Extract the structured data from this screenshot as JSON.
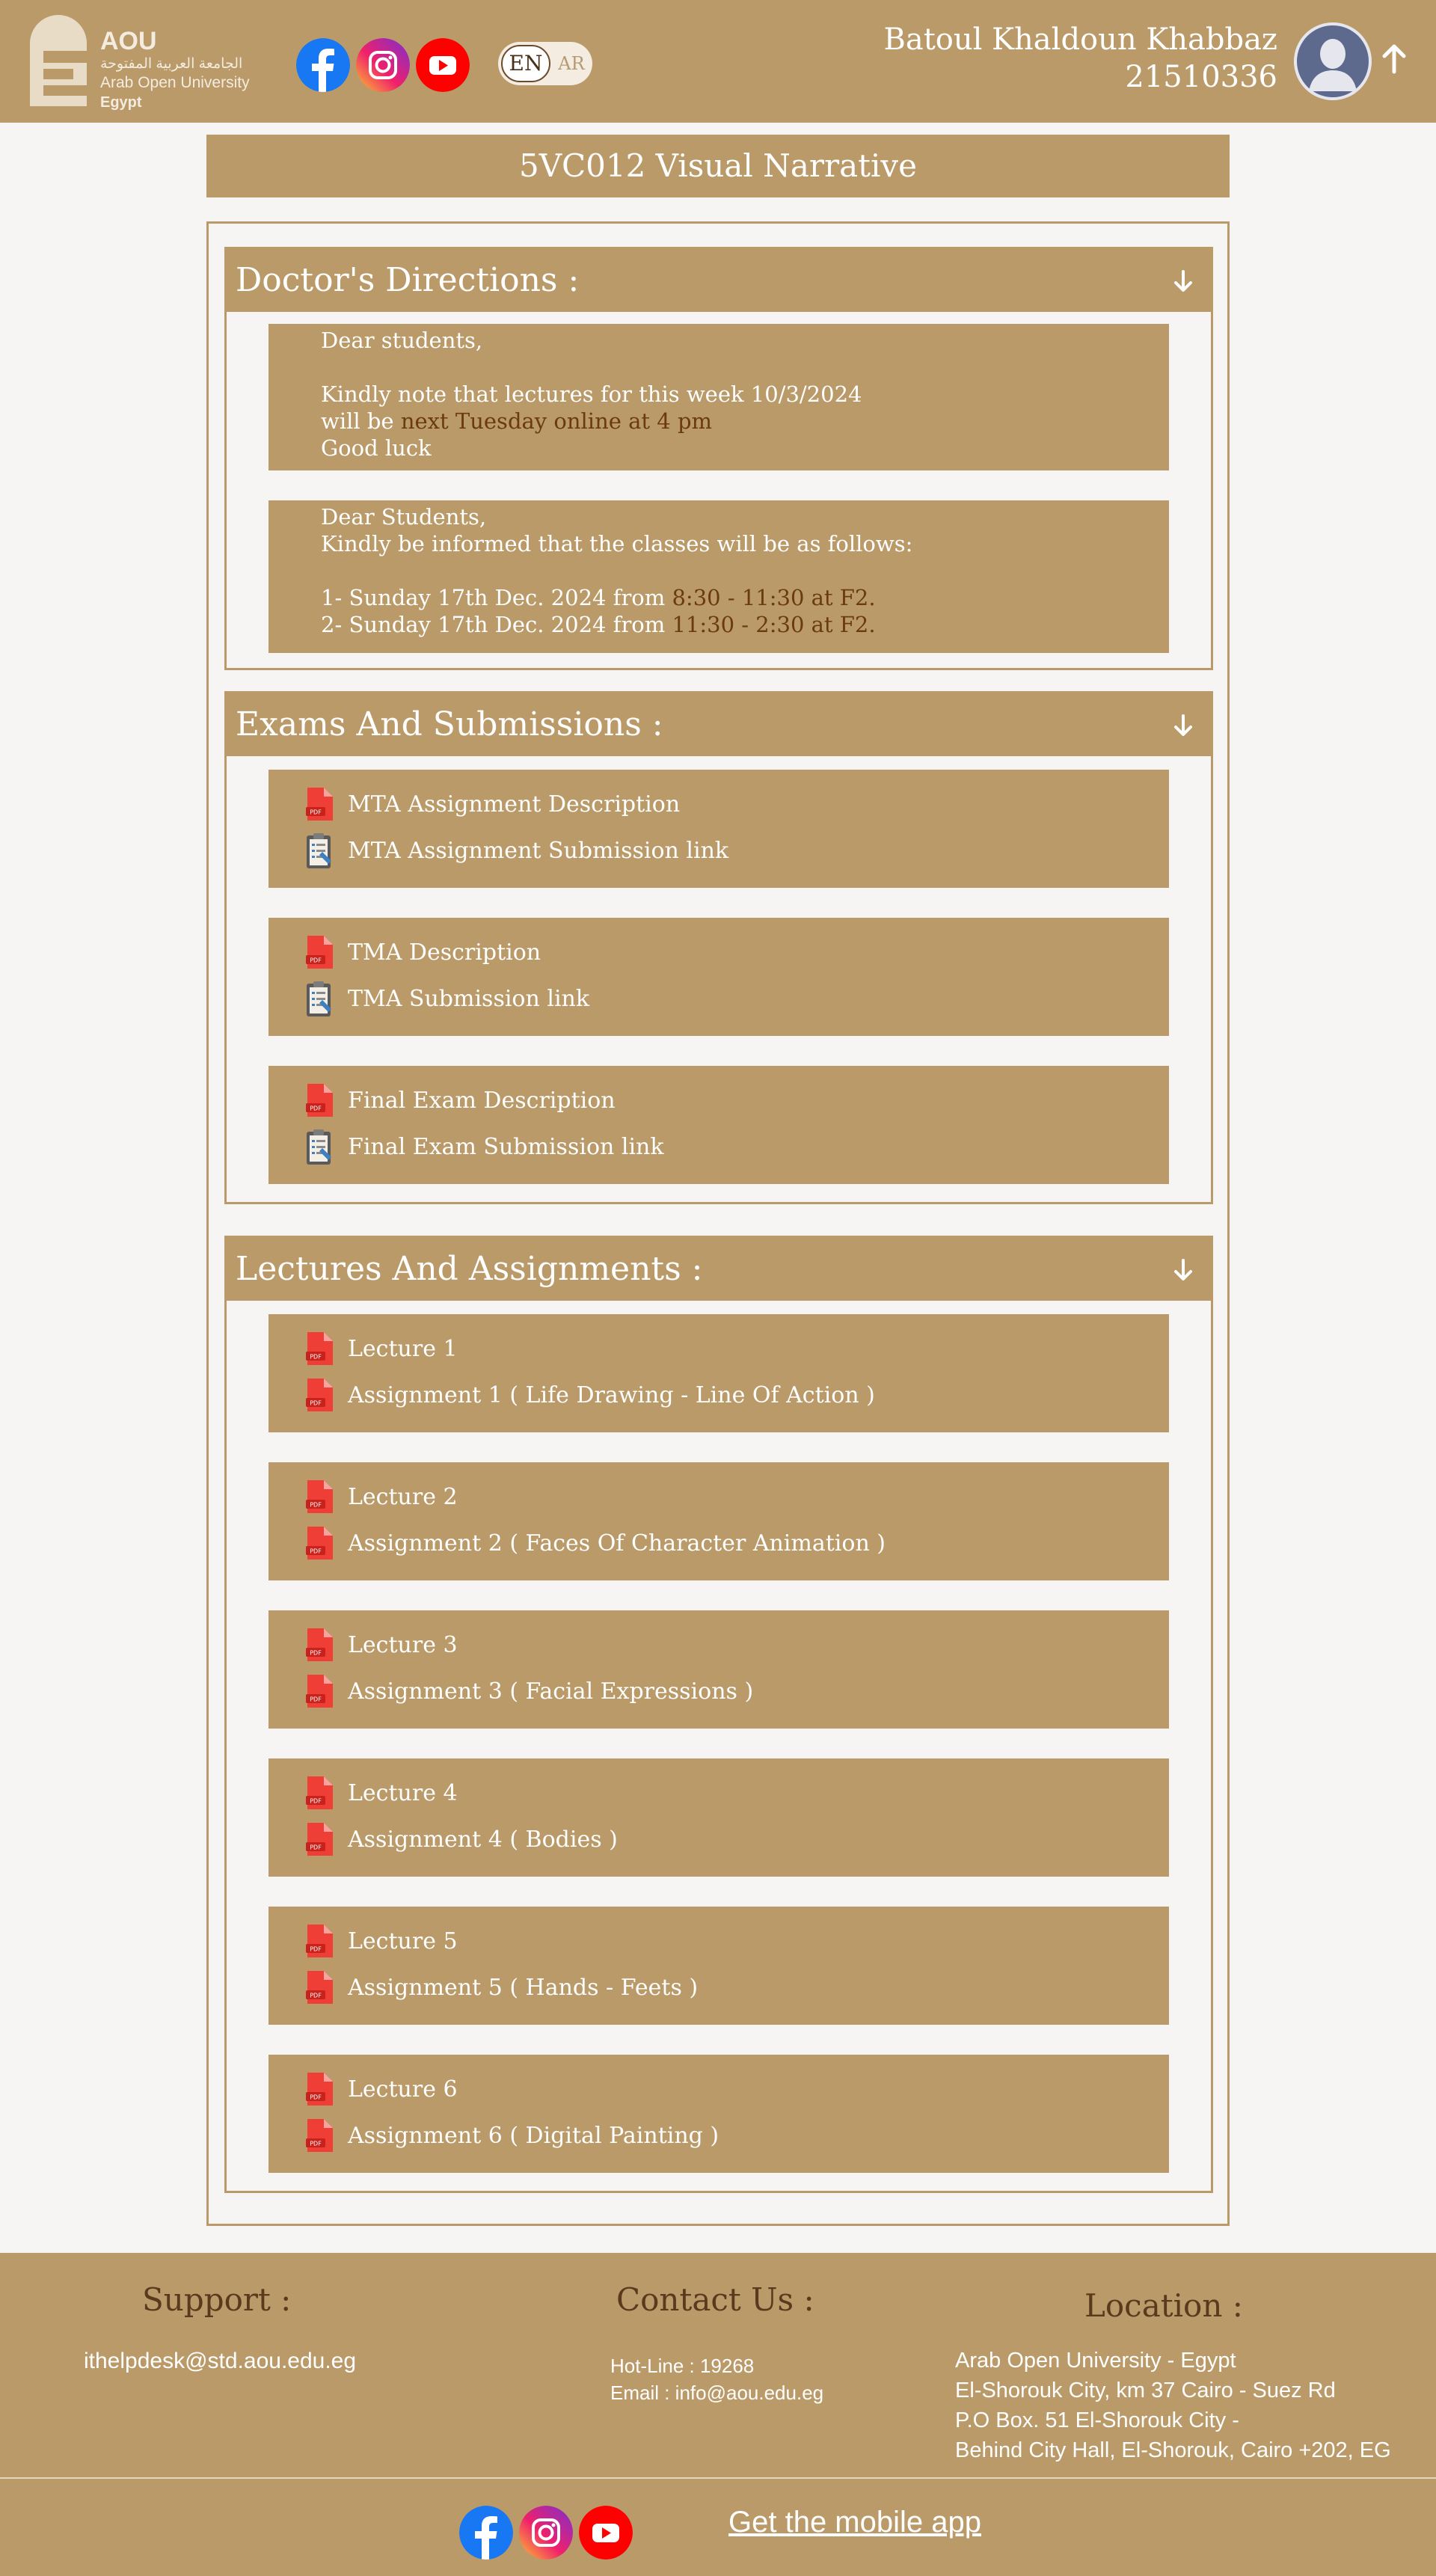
{
  "header": {
    "logo": {
      "abbr": "AOU",
      "arabic": "الجامعة العربية المفتوحة",
      "english": "Arab Open University",
      "country": "Egypt"
    },
    "social": [
      "facebook-icon",
      "instagram-icon",
      "youtube-icon"
    ],
    "lang": {
      "en": "EN",
      "ar": "AR"
    },
    "user_name": "Batoul Khaldoun Khabbaz",
    "user_id": "21510336"
  },
  "course_title": "5VC012 Visual Narrative",
  "sections": {
    "directions": {
      "title": "Doctor's Directions :",
      "ann1": {
        "l1": "Dear students,",
        "l2": "Kindly note that lectures for this week 10/3/2024",
        "l3a": "will be ",
        "l3b": "next Tuesday online at 4 pm",
        "l4": "Good luck"
      },
      "ann2": {
        "l1": "Dear Students,",
        "l2": "Kindly be informed that the classes will be as follows:",
        "l3a": "1- Sunday 17th Dec. 2024 from ",
        "l3b": "8:30 - 11:30 at F2.",
        "l4a": "2- Sunday 17th Dec. 2024 from ",
        "l4b": "11:30 - 2:30 at F2."
      }
    },
    "exams": {
      "title": "Exams And Submissions :",
      "cards": [
        {
          "a": "MTA Assignment Description",
          "b": "MTA Assignment Submission link"
        },
        {
          "a": "TMA Description",
          "b": "TMA Submission link"
        },
        {
          "a": "Final Exam Description",
          "b": "Final Exam Submission link"
        }
      ]
    },
    "lectures": {
      "title": "Lectures And Assignments :",
      "cards": [
        {
          "a": "Lecture 1",
          "b": "Assignment 1 ( Life Drawing - Line Of Action )"
        },
        {
          "a": "Lecture 2",
          "b": "Assignment 2 (  Faces Of Character Animation )"
        },
        {
          "a": "Lecture 3",
          "b": "Assignment 3 ( Facial Expressions )"
        },
        {
          "a": "Lecture 4",
          "b": "Assignment 4 ( Bodies )"
        },
        {
          "a": "Lecture 5",
          "b": "Assignment 5 ( Hands - Feets )"
        },
        {
          "a": "Lecture 6",
          "b": "Assignment 6 ( Digital Painting )"
        }
      ]
    }
  },
  "footer": {
    "support": {
      "title": "Support :",
      "email": "ithelpdesk@std.aou.edu.eg"
    },
    "contact": {
      "title": "Contact Us :",
      "hotline": "Hot-Line : 19268",
      "email": "Email : info@aou.edu.eg"
    },
    "location": {
      "title": "Location :",
      "l1": "Arab Open University - Egypt",
      "l2": "El-Shorouk City, km 37 Cairo - Suez Rd",
      "l3": "P.O Box. 51 El-Shorouk City -",
      "l4": "Behind City Hall, El-Shorouk, Cairo +202, EG"
    },
    "mobile_app": "Get the mobile app"
  },
  "colors": {
    "brand": "#ba9a68",
    "background": "#f7f5f4",
    "highlight": "#6b3a12",
    "heading_dark": "#5a3a1e"
  }
}
